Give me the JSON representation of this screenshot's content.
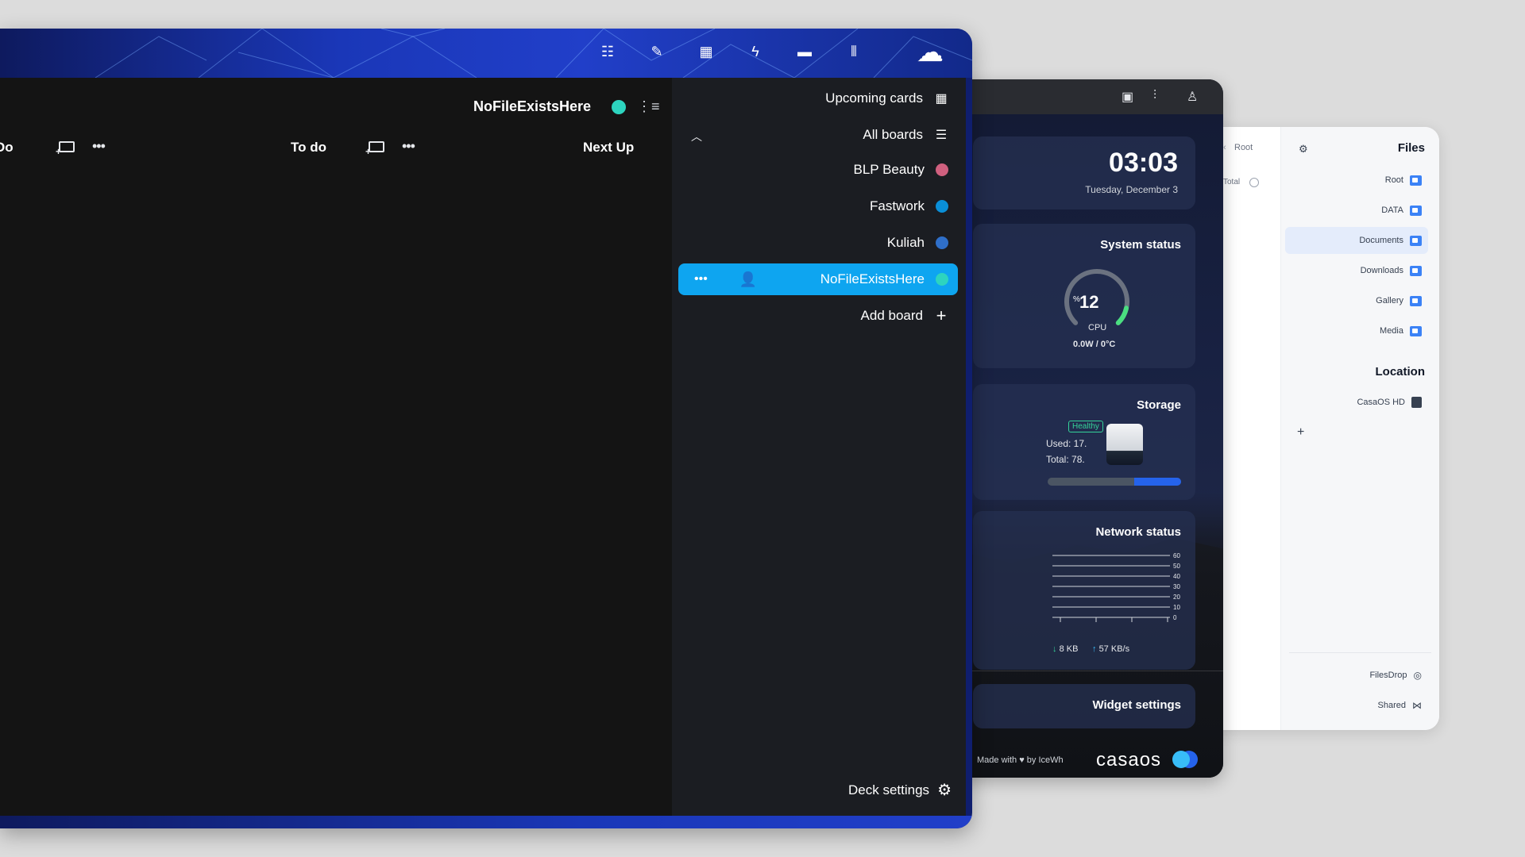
{
  "files": {
    "title": "Files",
    "breadcrumb": "Root",
    "total_label": "Total",
    "items": [
      {
        "label": "Root",
        "icon": "home-folder-icon"
      },
      {
        "label": "DATA",
        "icon": "folder-icon"
      },
      {
        "label": "Documents",
        "icon": "documents-folder-icon",
        "active": true
      },
      {
        "label": "Downloads",
        "icon": "downloads-folder-icon"
      },
      {
        "label": "Gallery",
        "icon": "gallery-folder-icon"
      },
      {
        "label": "Media",
        "icon": "media-folder-icon"
      }
    ],
    "location_title": "Location",
    "locations": [
      {
        "label": "CasaOS HD",
        "icon": "drive-icon"
      }
    ],
    "bottom": [
      {
        "label": "FilesDrop",
        "icon": "filesdrop-icon"
      },
      {
        "label": "Shared",
        "icon": "share-icon"
      }
    ]
  },
  "casa": {
    "time": "03:03",
    "date": "Tuesday, December 3",
    "system_status": "System status",
    "cpu_value": "12",
    "cpu_unit": "%",
    "cpu_percent": 12,
    "cpu_label": "CPU",
    "power": "0.0W / 0°C",
    "storage_title": "Storage",
    "storage_health": "Healthy",
    "storage_used": "Used: 17.",
    "storage_total": "Total: 78.",
    "storage_fill_fraction": 0.35,
    "network_title": "Network status",
    "network_ticks": [
      "60",
      "50",
      "40",
      "30",
      "20",
      "10",
      "0"
    ],
    "net_up": "57 KB/s",
    "net_down": "8 KB",
    "widget_settings": "Widget settings",
    "footer": "Made with ♥ by IceWh",
    "logo": "casaos",
    "colors": {
      "accent": "#2563eb",
      "healthy": "#34d399",
      "gauge": "#4ade80"
    }
  },
  "deck": {
    "board_title": "NoFileExistsHere",
    "stacks": [
      {
        "title": "Next Up"
      },
      {
        "title": "To do"
      },
      {
        "title": "Do"
      }
    ],
    "nav": {
      "upcoming": "Upcoming cards",
      "all_boards": "All boards",
      "boards": [
        {
          "label": "BLP Beauty",
          "color": "#d0607f"
        },
        {
          "label": "Fastwork",
          "color": "#0a8fd8"
        },
        {
          "label": "Kuliah",
          "color": "#2f6fc9"
        },
        {
          "label": "NoFileExistsHere",
          "color": "#2dd4bf",
          "active": true
        }
      ],
      "add_board": "Add board",
      "settings": "Deck settings"
    },
    "colors": {
      "active": "#0ea5f0",
      "sidebar": "#1b1d22",
      "main": "#141414"
    }
  }
}
